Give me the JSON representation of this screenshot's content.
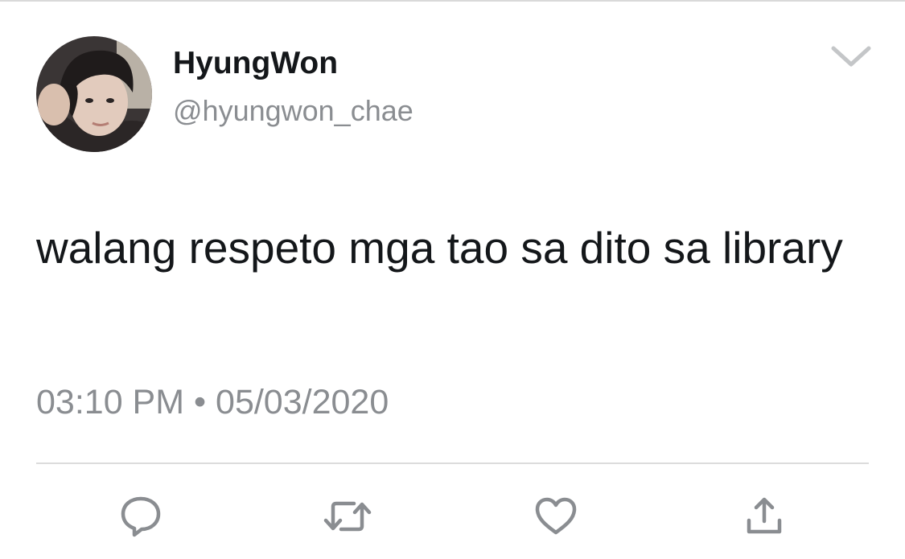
{
  "tweet": {
    "author": {
      "display_name": "HyungWon",
      "handle": "@hyungwon_chae",
      "avatar_icon": "profile-photo"
    },
    "text": "walang respeto mga tao sa dito sa library",
    "time": "03:10 PM",
    "separator": "•",
    "date": "05/03/2020"
  },
  "actions": [
    {
      "name": "reply",
      "icon": "speech-bubble-icon"
    },
    {
      "name": "retweet",
      "icon": "retweet-arrows-icon"
    },
    {
      "name": "like",
      "icon": "heart-icon"
    },
    {
      "name": "share",
      "icon": "share-upload-icon"
    }
  ],
  "colors": {
    "text_primary": "#14171a",
    "text_secondary": "#8a8d91",
    "icon": "#8a8d91",
    "divider": "#dcdcdc"
  }
}
